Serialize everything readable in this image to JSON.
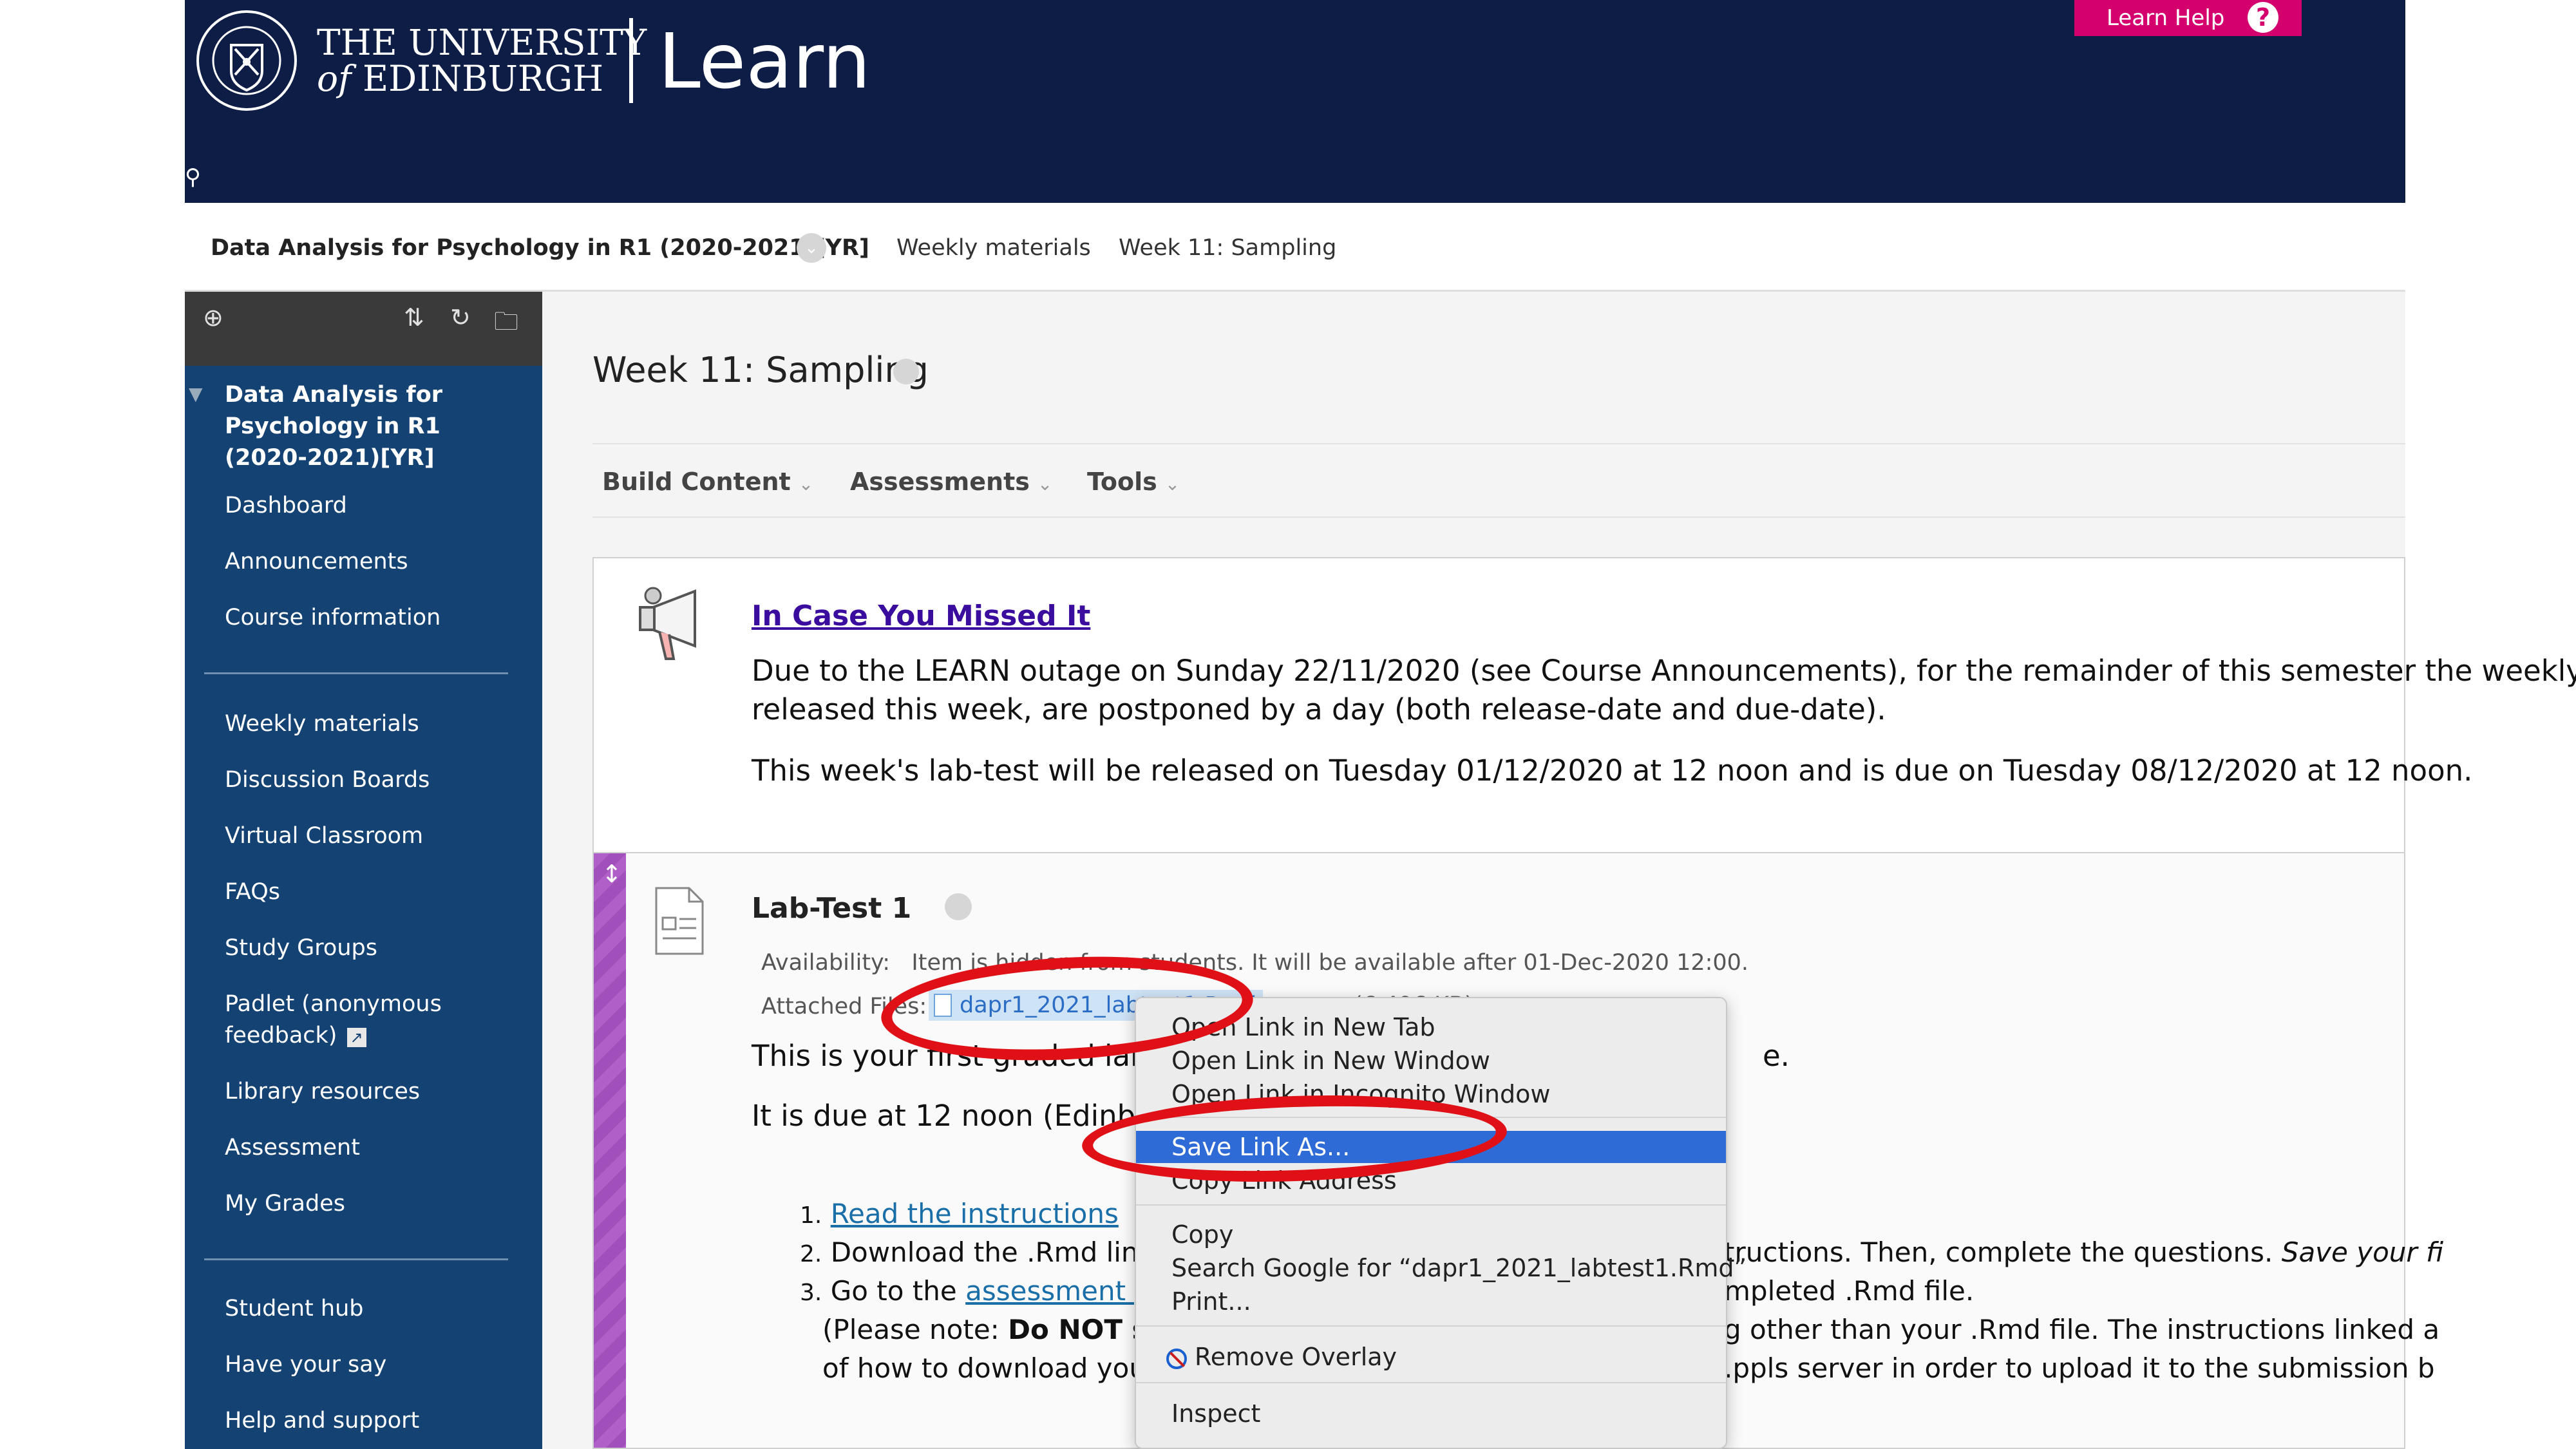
{
  "header": {
    "university_line1": "THE UNIVERSITY",
    "university_line2_of": "of",
    "university_line2": "EDINBURGH",
    "app_name": "Learn",
    "help_label": "Learn Help",
    "help_icon": "?",
    "pin_icon": "⚲",
    "colors": {
      "banner": "#0d1d45",
      "help": "#d4006e"
    }
  },
  "breadcrumb": {
    "course": "Data Analysis for Psychology in R1 (2020-2021)[YR]",
    "chevron": "⌄",
    "weekly": "Weekly materials",
    "current": "Week 11: Sampling"
  },
  "sidebar": {
    "toolbar_icons": [
      "⊕",
      "⇅",
      "↻",
      "🗀"
    ],
    "course_title": "Data Analysis for Psychology in R1 (2020-2021)[YR]",
    "collapse_icon": "▼",
    "group1": [
      "Dashboard",
      "Announcements",
      "Course information"
    ],
    "group2": [
      "Weekly materials",
      "Discussion Boards",
      "Virtual Classroom",
      "FAQs",
      "Study Groups",
      "Padlet (anonymous feedback)",
      "Library resources",
      "Assessment",
      "My Grades"
    ],
    "padlet_icon": "↗",
    "group3": [
      "Student hub",
      "Have your say",
      "Help and support"
    ],
    "colors": {
      "background": "#144272",
      "toolbar": "#3a3a3a"
    }
  },
  "main": {
    "page_title": "Week 11: Sampling",
    "action_bar": [
      {
        "label": "Build Content",
        "chevron": "⌄"
      },
      {
        "label": "Assessments",
        "chevron": "⌄"
      },
      {
        "label": "Tools",
        "chevron": "⌄"
      }
    ],
    "announcement": {
      "title": "In Case You Missed It",
      "line1": "Due to the LEARN outage on Sunday 22/11/2020 (see Course Announcements), for the remainder of this semester the weekly q",
      "line2": "released this week, are postponed by a day (both release-date and due-date).",
      "line3": "This week's lab-test will be released on Tuesday 01/12/2020 at 12 noon and is due on Tuesday 08/12/2020 at 12 noon."
    },
    "labtest": {
      "title": "Lab-Test 1",
      "drag_icon": "↕",
      "availability_label": "Availability:",
      "availability_text": "Item is hidden from students. It will be available after 01-Dec-2020 12:00.",
      "attached_label": "Attached Files:",
      "file_name": "dapr1_2021_labtest1.Rmd",
      "file_size": "(6.496 KB)",
      "intro_line": "This is your first graded lab te",
      "intro_end": "e.",
      "due_line": "It is due at 12 noon (Edinburgh",
      "list": [
        {
          "num": "1.",
          "link": "Read the instructions"
        },
        {
          "num": "2.",
          "text": "Download the .Rmd link",
          "tail": "tructions. Then, complete the questions.",
          "tail_italic": "Save your fi"
        },
        {
          "num": "3.",
          "text": "Go to the",
          "link": "assessment pa",
          "tail": "mpleted .Rmd file."
        }
      ],
      "note_start": "(Please note:",
      "note_bold": "Do NOT su",
      "note_tail": "g other than your .Rmd file. The instructions linked a",
      "note2_start": "of how to download you",
      "note2_tail": ".ppls server in order to upload it to the submission b"
    }
  },
  "context_menu": {
    "items": [
      "Open Link in New Tab",
      "Open Link in New Window",
      "Open Link in Incognito Window",
      "Save Link As...",
      "Copy Link Address",
      "Copy",
      "Search Google for “dapr1_2021_labtest1.Rmd”",
      "Print...",
      "Remove Overlay",
      "Inspect"
    ],
    "selected": "Save Link As...",
    "colors": {
      "highlight": "#2f6bd7"
    }
  },
  "annotation": {
    "color": "#e01017"
  }
}
